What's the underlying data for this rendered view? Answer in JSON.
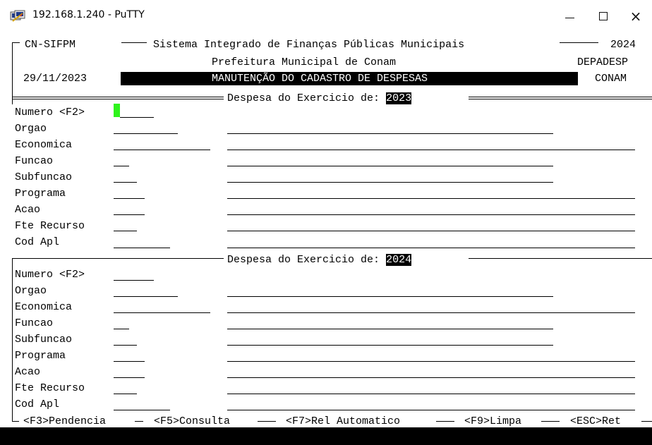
{
  "window": {
    "title": "192.168.1.240 - PuTTY",
    "icon": "putty-icon",
    "controls": {
      "minimize": "minimize-icon",
      "maximize": "maximize-icon",
      "close": "close-icon",
      "close_glyph": "×"
    }
  },
  "header": {
    "system_code": "CN-SIFPM",
    "system_name": "Sistema Integrado de Finanças Públicas Municipais",
    "year": "2024",
    "org_name": "Prefeitura Municipal de Conam",
    "program_code": "DEPADESP",
    "date": "29/11/2023",
    "screen_title": "MANUTENÇÃO DO CADASTRO DE DESPESAS",
    "user": "CONAM"
  },
  "section1": {
    "title_prefix": "Despesa do Exercicio de:",
    "year": "2023",
    "fields": [
      "Numero <F2>",
      "Orgao",
      "Economica",
      "Funcao",
      "Subfuncao",
      "Programa",
      "Acao",
      "Fte Recurso",
      "Cod Apl"
    ]
  },
  "section2": {
    "title_prefix": "Despesa do Exercicio de:",
    "year": "2024",
    "fields": [
      "Numero <F2>",
      "Orgao",
      "Economica",
      "Funcao",
      "Subfuncao",
      "Programa",
      "Acao",
      "Fte Recurso",
      "Cod Apl"
    ]
  },
  "footer": {
    "keys": [
      "<F3>Pendencia",
      "<F5>Consulta",
      "<F7>Rel Automatico",
      "<F9>Limpa",
      "<ESC>Ret"
    ]
  },
  "colors": {
    "cursor": "#2ff31c",
    "background": "#ffffff",
    "text": "#000000"
  }
}
